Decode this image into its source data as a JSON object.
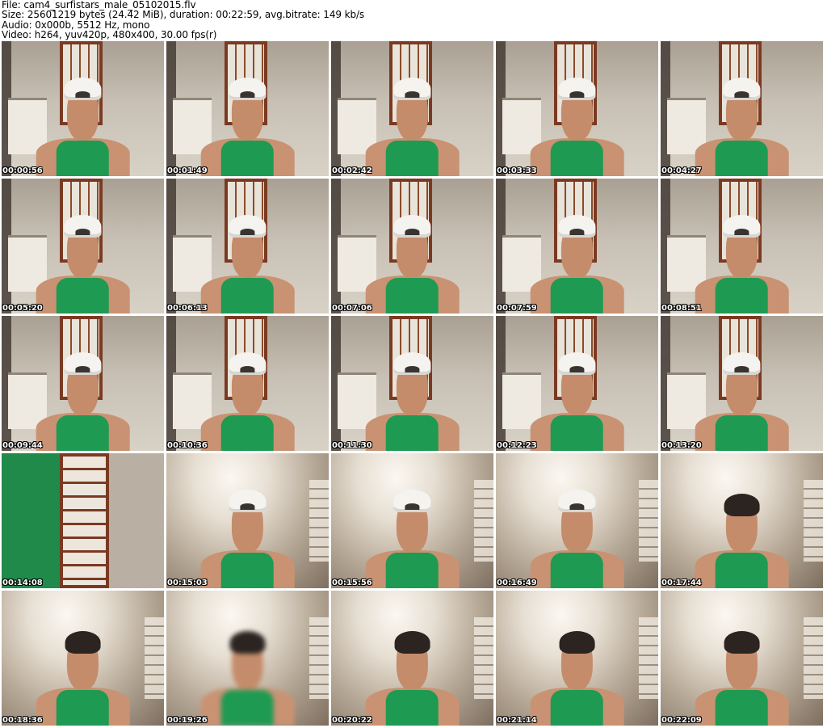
{
  "header": {
    "file": "File: cam4_surfistars_male_05102015.flv",
    "size": "Size: 25601219 bytes (24.42 MiB), duration: 00:22:59, avg.bitrate: 149 kb/s",
    "audio": "Audio: 0x000b, 5512 Hz, mono",
    "video": "Video: h264, yuv420p, 480x400, 30.00 fps(r)"
  },
  "thumbnails": [
    {
      "time": "00:00:56",
      "scene": "kitchen",
      "cap": true
    },
    {
      "time": "00:01:49",
      "scene": "kitchen",
      "cap": true
    },
    {
      "time": "00:02:42",
      "scene": "kitchen",
      "cap": true
    },
    {
      "time": "00:03:33",
      "scene": "kitchen",
      "cap": true
    },
    {
      "time": "00:04:27",
      "scene": "kitchen",
      "cap": true
    },
    {
      "time": "00:05:20",
      "scene": "kitchen",
      "cap": true
    },
    {
      "time": "00:06:13",
      "scene": "kitchen",
      "cap": true
    },
    {
      "time": "00:07:06",
      "scene": "kitchen",
      "cap": true
    },
    {
      "time": "00:07:59",
      "scene": "kitchen",
      "cap": true
    },
    {
      "time": "00:08:51",
      "scene": "kitchen",
      "cap": true
    },
    {
      "time": "00:09:44",
      "scene": "kitchen",
      "cap": true
    },
    {
      "time": "00:10:36",
      "scene": "kitchen",
      "cap": true
    },
    {
      "time": "00:11:30",
      "scene": "kitchen",
      "cap": true
    },
    {
      "time": "00:12:23",
      "scene": "kitchen",
      "cap": true
    },
    {
      "time": "00:13:20",
      "scene": "kitchen",
      "cap": true
    },
    {
      "time": "00:14:08",
      "scene": "door",
      "cap": false
    },
    {
      "time": "00:15:03",
      "scene": "ceiling",
      "cap": true
    },
    {
      "time": "00:15:56",
      "scene": "ceiling",
      "cap": true
    },
    {
      "time": "00:16:49",
      "scene": "ceiling",
      "cap": true
    },
    {
      "time": "00:17:44",
      "scene": "ceiling",
      "cap": false
    },
    {
      "time": "00:18:36",
      "scene": "ceiling",
      "cap": false
    },
    {
      "time": "00:19:26",
      "scene": "ceiling",
      "cap": false
    },
    {
      "time": "00:20:22",
      "scene": "ceiling",
      "cap": false
    },
    {
      "time": "00:21:14",
      "scene": "ceiling",
      "cap": false
    },
    {
      "time": "00:22:09",
      "scene": "ceiling",
      "cap": false
    }
  ]
}
